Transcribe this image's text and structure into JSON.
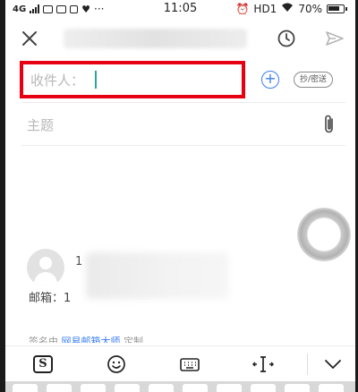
{
  "status_bar": {
    "network": "4G",
    "time": "11:05",
    "hd": "HD1",
    "battery": "70%"
  },
  "compose": {
    "recipient_label": "收件人：",
    "ccbcc_label": "抄/密送",
    "subject_placeholder": "主题",
    "signature_mailbox_label": "邮箱：1",
    "signature_name_hint": "1",
    "footer_prefix": "签名由",
    "footer_link": "网易邮箱大师",
    "footer_suffix": "定制"
  },
  "colors": {
    "highlight_border": "#e60012",
    "accent_blue": "#3a7ef0",
    "caret": "#2aa39a"
  },
  "icons": {
    "close": "close-icon",
    "schedule": "clock-icon",
    "send": "send-icon",
    "add_contact": "plus-circle-icon",
    "attachment": "paperclip-icon",
    "keyboard_logo": "sogou-icon",
    "emoji": "emoji-icon",
    "keyboard": "keyboard-icon",
    "cursor_move": "text-cursor-icon",
    "collapse": "chevron-down-icon"
  }
}
